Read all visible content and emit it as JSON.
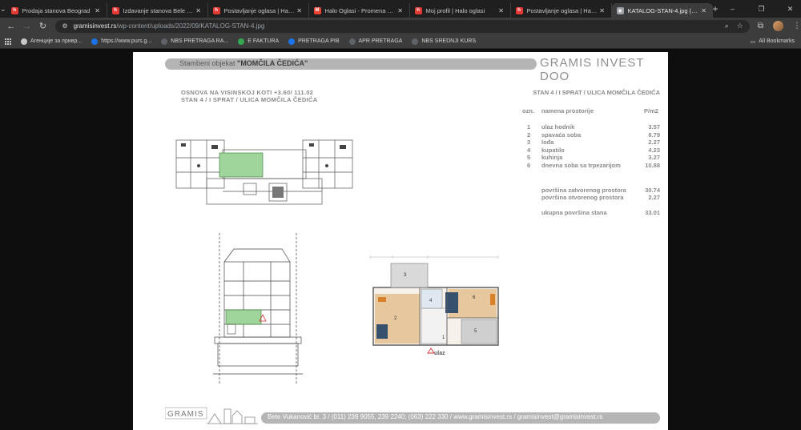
{
  "tabs": [
    {
      "title": "Prodaja stanova Beograd",
      "color": "#e53935",
      "glyph": "h"
    },
    {
      "title": "Izdavanje stanova Bele vode | H",
      "color": "#e53935",
      "glyph": "h"
    },
    {
      "title": "Postavljanje oglasa | Halo oglas",
      "color": "#e53935",
      "glyph": "h"
    },
    {
      "title": "Halo Oglasi - Promena vaše loz",
      "color": "#ea4335",
      "glyph": "M"
    },
    {
      "title": "Moj profil | Halo oglasi",
      "color": "#e53935",
      "glyph": "h"
    },
    {
      "title": "Postavljanje oglasa | Halo ogla",
      "color": "#e53935",
      "glyph": "h"
    },
    {
      "title": "KATALOG-STAN-4.jpg (1920×1",
      "color": "#9aa0a6",
      "glyph": "◉",
      "active": true
    }
  ],
  "url": {
    "host": "gramisinvest.rs",
    "path": "/wp-content/uploads/2022/09/KATALOG-STAN-4.jpg"
  },
  "bookmarks": [
    {
      "label": "Агенције за привр...",
      "color": "#c9c9c9"
    },
    {
      "label": "https://www.purs.g...",
      "color": "#1a73e8"
    },
    {
      "label": "NBS PRETRAGA RA...",
      "color": "#5f6368"
    },
    {
      "label": "E FAKTURA",
      "color": "#34a853"
    },
    {
      "label": "PRETRAGA PIB",
      "color": "#1a73e8"
    },
    {
      "label": "APR PRETRAGA",
      "color": "#5f6368"
    },
    {
      "label": "NBS SREDNJI KURS",
      "color": "#5f6368"
    }
  ],
  "all_bookmarks": "All Bookmarks",
  "doc": {
    "header_prefix": "Stambeni objekat ",
    "header_name": "\"MOMČILA ČEDIĆA\"",
    "company": "GRAMIS INVEST DOO",
    "subtitle1": "OSNOVA NA VISINSKOJ KOTI +3.60/ 111.02",
    "subtitle2": "STAN 4 / I SPRAT / ULICA MOMČILA ČEDIĆA",
    "right_title": "STAN 4 / I SPRAT / ULICA MOMČILA ČEDIĆA",
    "col_ozn": "ozn.",
    "col_name": "namena prostorije",
    "col_area": "P/m2",
    "rooms": [
      {
        "no": "1",
        "name": "ulaz hodnik",
        "area": "3.57"
      },
      {
        "no": "2",
        "name": "spavaća soba",
        "area": "8.79"
      },
      {
        "no": "3",
        "name": "lođa",
        "area": "2.27"
      },
      {
        "no": "4",
        "name": "kupatilo",
        "area": "4.23"
      },
      {
        "no": "5",
        "name": "kuhinja",
        "area": "3.27"
      },
      {
        "no": "6",
        "name": "dnevna soba sa trpezarijom",
        "area": "10.88"
      }
    ],
    "closed_label": "površina zatvorenog prostora",
    "closed_value": "30.74",
    "open_label": "površina otvorenog prostora",
    "open_value": "2.27",
    "total_label": "ukupna površina stana",
    "total_value": "33.01",
    "entrance": "ulaz",
    "footer": "Bete Vukanović br. 3 / (011) 239 9055, 239 2240; (063) 222 330 / www.gramisinvest.rs / gramisinvest@gramisinvest.rs",
    "logo_text": "GRAMIS"
  }
}
